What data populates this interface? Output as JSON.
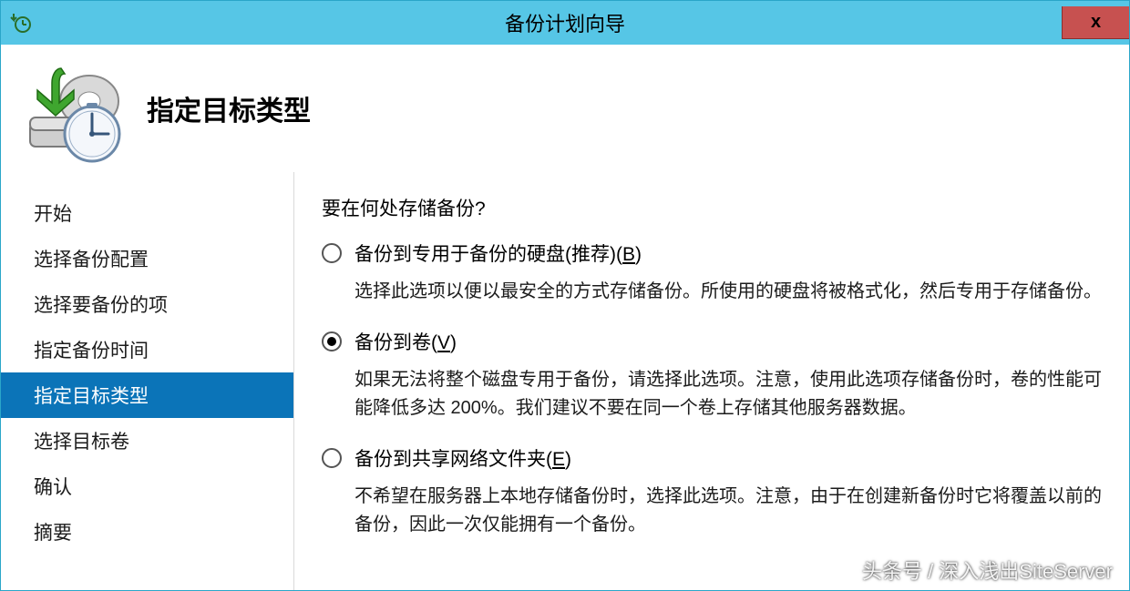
{
  "titlebar": {
    "title": "备份计划向导",
    "close_label": "x"
  },
  "header": {
    "page_title": "指定目标类型"
  },
  "sidebar": {
    "items": [
      {
        "label": "开始",
        "active": false
      },
      {
        "label": "选择备份配置",
        "active": false
      },
      {
        "label": "选择要备份的项",
        "active": false
      },
      {
        "label": "指定备份时间",
        "active": false
      },
      {
        "label": "指定目标类型",
        "active": true
      },
      {
        "label": "选择目标卷",
        "active": false
      },
      {
        "label": "确认",
        "active": false
      },
      {
        "label": "摘要",
        "active": false
      }
    ]
  },
  "main": {
    "question": "要在何处存储备份?",
    "options": [
      {
        "label_prefix": "备份到专用于备份的硬盘(推荐)(",
        "accelerator": "B",
        "label_suffix": ")",
        "checked": false,
        "desc": "选择此选项以便以最安全的方式存储备份。所使用的硬盘将被格式化，然后专用于存储备份。"
      },
      {
        "label_prefix": "备份到卷(",
        "accelerator": "V",
        "label_suffix": ")",
        "checked": true,
        "desc": "如果无法将整个磁盘专用于备份，请选择此选项。注意，使用此选项存储备份时，卷的性能可能降低多达 200%。我们建议不要在同一个卷上存储其他服务器数据。"
      },
      {
        "label_prefix": "备份到共享网络文件夹(",
        "accelerator": "E",
        "label_suffix": ")",
        "checked": false,
        "desc": "不希望在服务器上本地存储备份时，选择此选项。注意，由于在创建新备份时它将覆盖以前的备份，因此一次仅能拥有一个备份。"
      }
    ]
  },
  "watermark": "头条号 / 深入浅出SiteServer"
}
